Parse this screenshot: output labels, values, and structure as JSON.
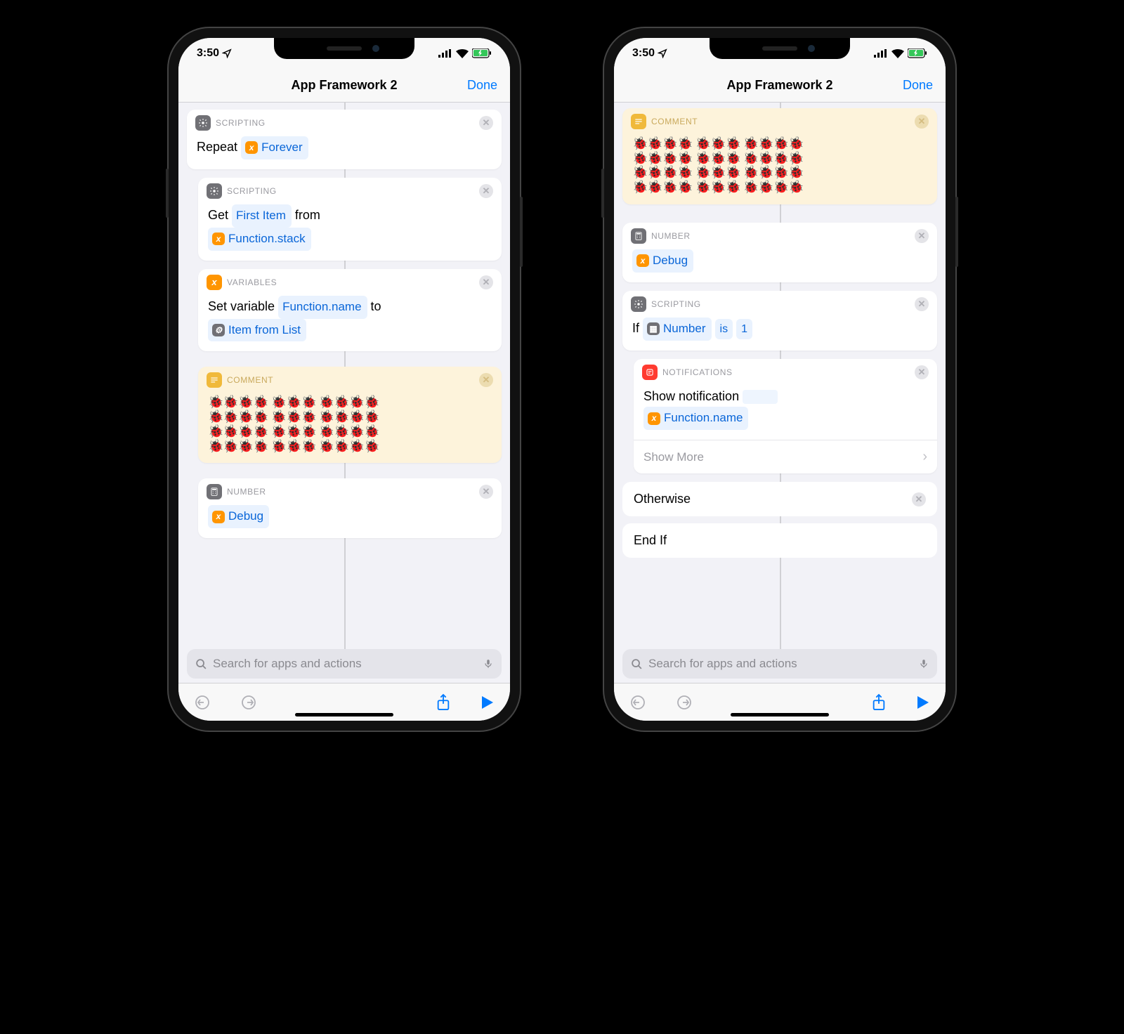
{
  "status": {
    "time": "3:50",
    "loc_icon": "location-arrow"
  },
  "nav": {
    "title": "App Framework 2",
    "done": "Done"
  },
  "categories": {
    "scripting": "SCRIPTING",
    "variables": "VARIABLES",
    "comment": "COMMENT",
    "number": "NUMBER",
    "notifications": "NOTIFICATIONS"
  },
  "left_phone": {
    "repeat": {
      "label": "Repeat",
      "token": "Forever"
    },
    "get": {
      "label1": "Get",
      "token1": "First Item",
      "label2": "from",
      "token2": "Function.stack"
    },
    "setvar": {
      "label1": "Set variable",
      "token1": "Function.name",
      "label2": "to",
      "token2": "Item from List"
    },
    "number": {
      "token": "Debug"
    }
  },
  "comment_text": "🐞🐞🐞🐞 🐞🐞🐞 🐞🐞🐞🐞\n🐞🐞🐞🐞 🐞🐞🐞 🐞🐞🐞🐞\n🐞🐞🐞🐞 🐞🐞🐞 🐞🐞🐞🐞\n🐞🐞🐞🐞 🐞🐞🐞 🐞🐞🐞🐞",
  "right_phone": {
    "number": {
      "token": "Debug"
    },
    "if": {
      "label": "If",
      "token1": "Number",
      "op": "is",
      "val": "1"
    },
    "notif": {
      "label": "Show notification",
      "token": "Function.name",
      "more": "Show More"
    },
    "otherwise": "Otherwise",
    "endif": "End If"
  },
  "search_placeholder": "Search for apps and actions"
}
